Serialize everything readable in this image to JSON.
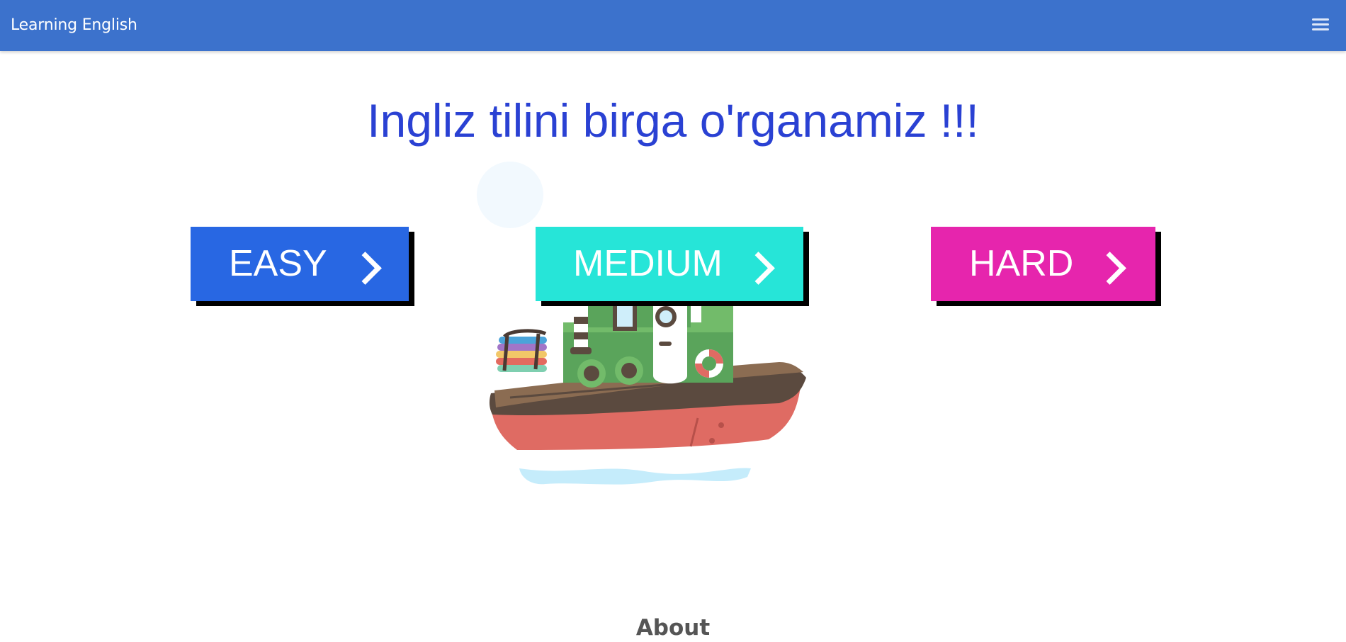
{
  "navbar": {
    "brand": "Learning English",
    "menu_icon": "hamburger-menu-icon"
  },
  "hero": {
    "title": "Ingliz tilini birga o'rganamiz !!!"
  },
  "levels": [
    {
      "label": "EASY",
      "color": "#2867e3",
      "icon": "chevron-right-icon"
    },
    {
      "label": "MEDIUM",
      "color": "#26e5d8",
      "icon": "chevron-right-icon"
    },
    {
      "label": "HARD",
      "color": "#e625ad",
      "icon": "chevron-right-icon"
    }
  ],
  "illustration": {
    "icon": "tugboat-illustration"
  },
  "about": {
    "heading": "About"
  },
  "colors": {
    "navbar": "#3c72cc",
    "heading": "#2a41d3",
    "button_shadow": "#000000"
  }
}
